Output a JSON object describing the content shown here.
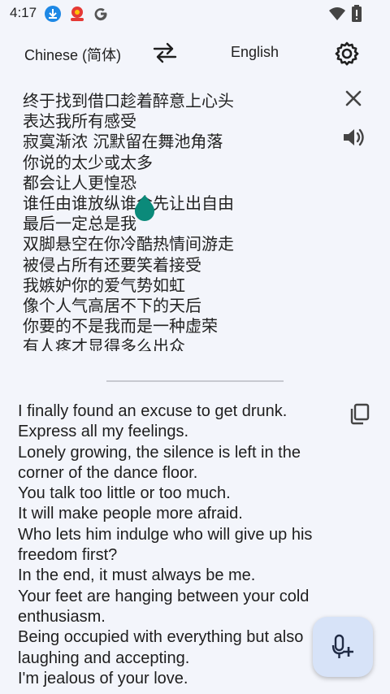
{
  "status_bar": {
    "time": "4:17",
    "icons": [
      "download-icon",
      "app-notification-icon",
      "google-icon",
      "wifi-icon",
      "battery-icon"
    ],
    "colors": {
      "download": "#1e88e5",
      "app": "#e53935"
    }
  },
  "languages": {
    "source": "Chinese (简体)",
    "target": "English"
  },
  "source_text": {
    "lines": [
      "终于找到借口趁着醉意上心头",
      "表达我所有感受",
      "寂寞渐浓 沉默留在舞池角落",
      "你说的太少或太多",
      "都会让人更惶恐",
      "谁任由谁放纵谁会先让出自由",
      "最后一定总是我",
      "双脚悬空在你冷酷热情间游走",
      "被侵占所有还要笑着接受",
      "我嫉妒你的爱气势如虹",
      "像个人气高居不下的天后",
      "你要的不是我而是一种虚荣",
      "有人疼才显得多么出众"
    ]
  },
  "translation": {
    "lines": [
      "I finally found an excuse to get drunk.",
      "Express all my feelings.",
      "Lonely growing, the silence is left in the",
      "corner of the dance floor.",
      "You talk too little or too much.",
      "It will make people more afraid.",
      "Who lets him indulge who will give up his",
      "freedom first?",
      "In the end, it must always be me.",
      "Your feet are hanging between your cold",
      "enthusiasm.",
      "Being occupied with everything but also",
      "laughing and accepting.",
      "I'm jealous of your love."
    ]
  },
  "colors": {
    "background": "#f3f5fb",
    "fab": "#d7e3f8",
    "cursor_handle": "#0b8a7a"
  }
}
